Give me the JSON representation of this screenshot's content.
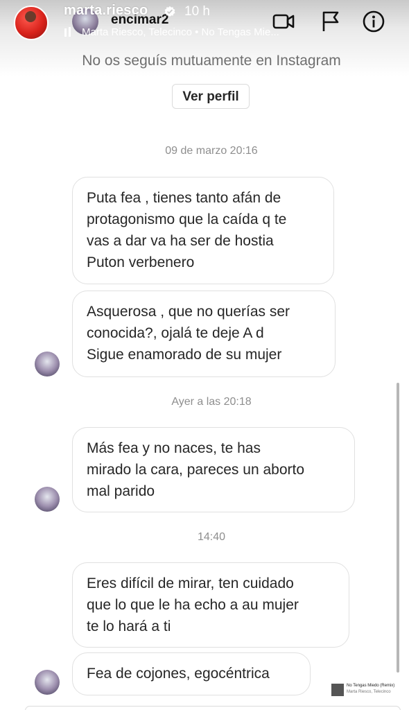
{
  "story": {
    "username": "marta.riesco",
    "time": "10 h",
    "music": "Marta Riesco, Telecinco • No Tengas Mie..."
  },
  "dm": {
    "contact_name": "encimar2",
    "mutual_text": "No os seguís mutuamente en Instagram",
    "view_profile": "Ver perfil"
  },
  "thread": {
    "timestamps": [
      "09 de marzo 20:16",
      "Ayer a las 20:18",
      "14:40"
    ],
    "messages": [
      "Puta fea , tienes tanto afán de\nprotagonismo que la caída q te\nvas a dar va ha ser de hostia\nPuton verbenero",
      "Asquerosa , que no querías ser\nconocida?, ojalá te deje  A d\nSigue enamorado de su mujer",
      "Más fea y no naces, te has\nmirado la cara, pareces un aborto\nmal parido",
      "Eres difícil de mirar, ten cuidado\nque lo que le ha  echo a au mujer\nte lo hará a ti",
      "Fea de cojones, egocéntrica"
    ]
  },
  "music_sticker": {
    "title": "No Tengas Miedo (Remix)",
    "artist": "Marta Riesco, Telecinco"
  },
  "icons": {
    "video": "video-camera-icon",
    "flag": "flag-icon",
    "info": "info-icon",
    "verified": "verified-badge-icon",
    "music": "music-note-icon"
  },
  "colors": {
    "timestamp": "#8e8e8e",
    "bubble_border": "#e0e0e0",
    "text": "#262626",
    "verified": "#ffffff"
  }
}
